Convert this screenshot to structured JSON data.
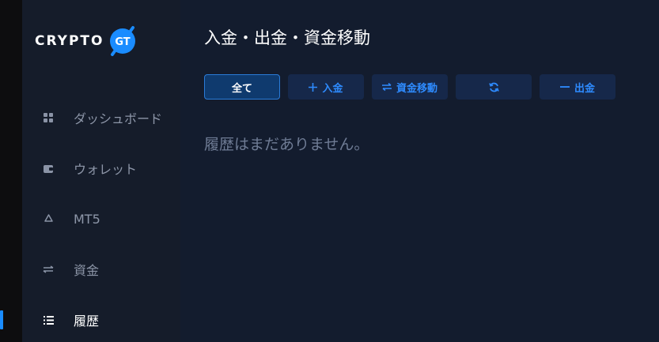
{
  "logo": {
    "text": "CRYPTO",
    "badge_text": "GT",
    "accent_color": "#1a8cff"
  },
  "sidebar": {
    "items": [
      {
        "label": "ダッシュボード",
        "icon": "grid-icon",
        "active": false
      },
      {
        "label": "ウォレット",
        "icon": "wallet-icon",
        "active": false
      },
      {
        "label": "MT5",
        "icon": "recycle-icon",
        "active": false
      },
      {
        "label": "資金",
        "icon": "transfer-arrows-icon",
        "active": false
      },
      {
        "label": "履歴",
        "icon": "list-icon",
        "active": true
      }
    ]
  },
  "main": {
    "title": "入金・出金・資金移動",
    "filters": [
      {
        "label": "全て",
        "icon": "",
        "active": true
      },
      {
        "label": "入金",
        "icon": "plus-icon",
        "active": false
      },
      {
        "label": "資金移動",
        "icon": "swap-icon",
        "active": false
      },
      {
        "label": "",
        "icon": "refresh-icon",
        "active": false
      },
      {
        "label": "出金",
        "icon": "minus-icon",
        "active": false
      }
    ],
    "empty_message": "履歴はまだありません。"
  },
  "colors": {
    "background": "#131c2e",
    "sidebar": "#151c2a",
    "accent": "#1a8cff",
    "button_bg": "#16284a",
    "active_button_bg": "#0f3a6e"
  }
}
